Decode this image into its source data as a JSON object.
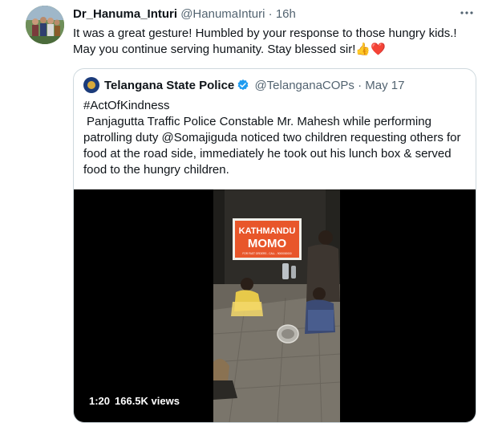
{
  "tweet": {
    "display_name": "Dr_Hanuma_Inturi",
    "handle": "@HanumaInturi",
    "separator": "·",
    "time": "16h",
    "more_icon": "more-dots-icon",
    "text": "It was a great gesture! Humbled by your response to those hungry kids.! May you continue serving humanity. Stay blessed sir!",
    "emojis": [
      "👍",
      "❤️"
    ]
  },
  "quoted": {
    "display_name": "Telangana State Police",
    "verified_icon": "verified-badge-icon",
    "handle": "@TelanganaCOPs",
    "separator": "·",
    "date": "May 17",
    "hashtag": "#ActOfKindness",
    "body": "Panjagutta Traffic Police Constable Mr. Mahesh while performing patrolling duty @Somajiguda noticed two children requesting others for food at the road side, immediately he took out his lunch box  & served food to the hungry children.",
    "video": {
      "sign_line1": "KATHMANDU",
      "sign_line2": "MOMO",
      "sign_small": "FOR FAST ORDERS - CALL - 9000000000",
      "duration": "1:20",
      "views": "166.5K views"
    }
  },
  "colors": {
    "secondary_text": "#536471",
    "border": "#cfd9de",
    "verified_blue": "#1d9bf0",
    "sign_orange": "#e8562a"
  }
}
